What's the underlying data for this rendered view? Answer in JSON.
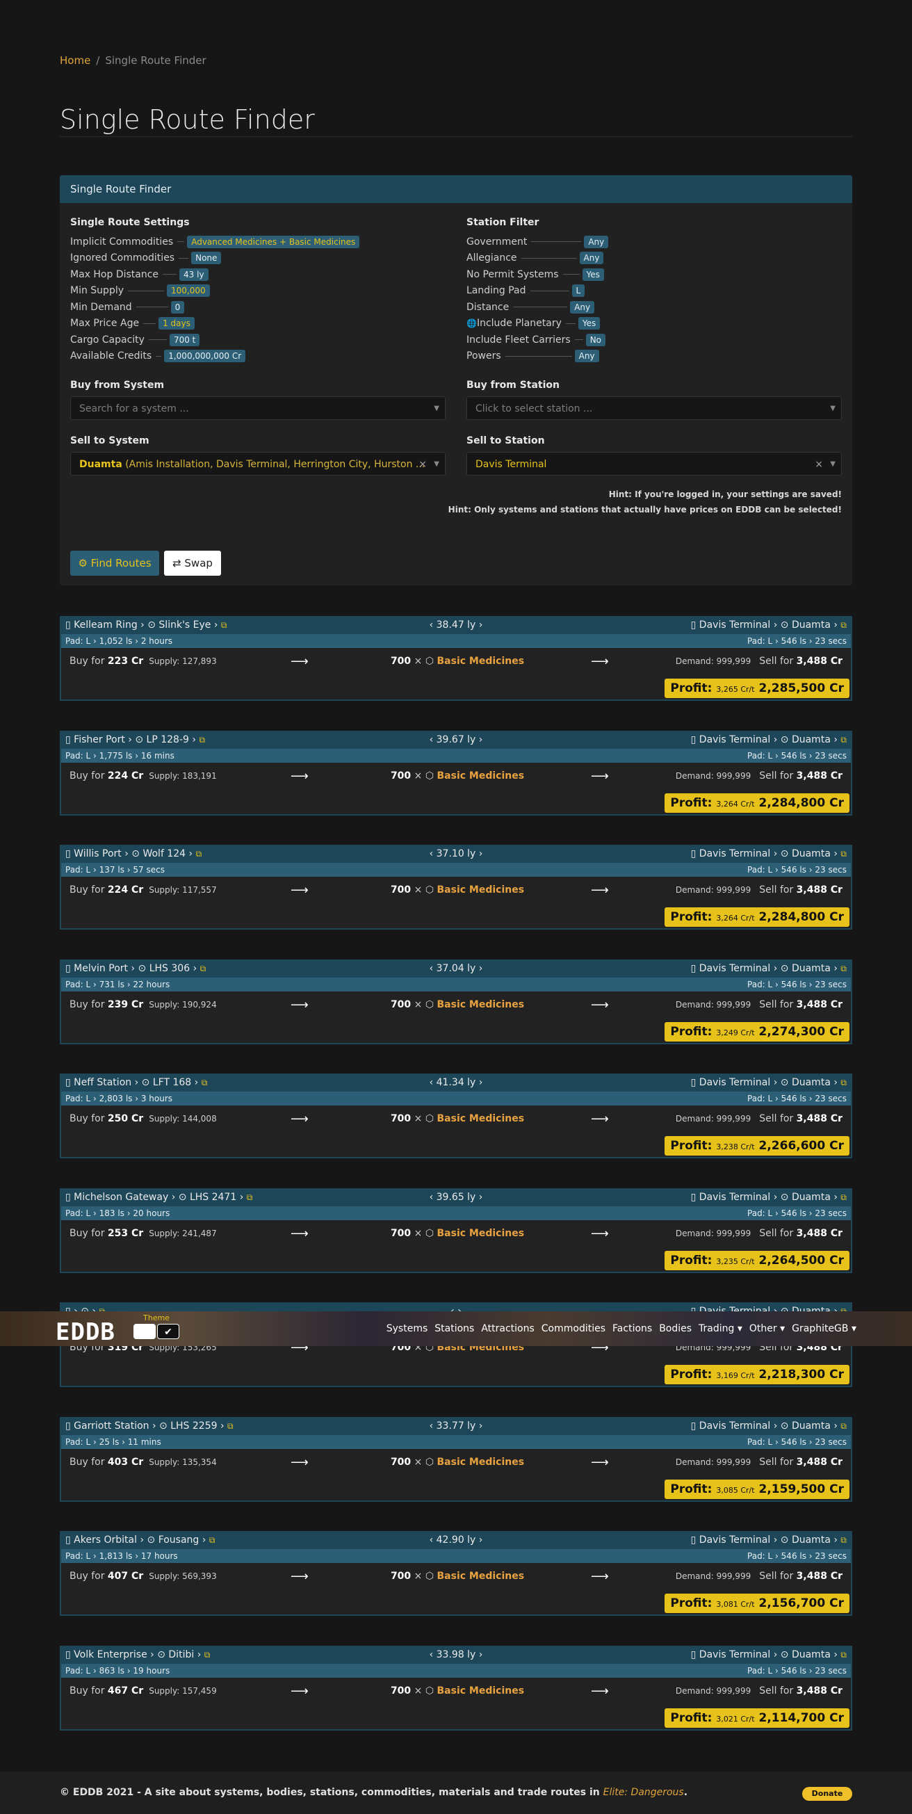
{
  "breadcrumb": {
    "home": "Home",
    "sep": "/",
    "current": "Single Route Finder"
  },
  "title": "Single Route Finder",
  "panel": {
    "header": "Single Route Finder",
    "settings": {
      "title": "Single Route Settings",
      "rows": [
        {
          "label": "Implicit Commodities",
          "value": "Advanced Medicines + Basic Medicines",
          "yellow": true
        },
        {
          "label": "Ignored Commodities",
          "value": "None",
          "yellow": false
        },
        {
          "label": "Max Hop Distance",
          "value": "43 ly",
          "yellow": false
        },
        {
          "label": "Min Supply",
          "value": "100,000",
          "yellow": true
        },
        {
          "label": "Min Demand",
          "value": "0",
          "yellow": false
        },
        {
          "label": "Max Price Age",
          "value": "1 days",
          "yellow": true
        },
        {
          "label": "Cargo Capacity",
          "value": "700 t",
          "yellow": false
        },
        {
          "label": "Available Credits",
          "value": "1,000,000,000 Cr",
          "yellow": false
        }
      ]
    },
    "filter": {
      "title": "Station Filter",
      "rows": [
        {
          "label": "Government",
          "value": "Any",
          "icon": ""
        },
        {
          "label": "Allegiance",
          "value": "Any",
          "icon": ""
        },
        {
          "label": "No Permit Systems",
          "value": "Yes",
          "icon": ""
        },
        {
          "label": "Landing Pad",
          "value": "L",
          "icon": ""
        },
        {
          "label": "Distance",
          "value": "Any",
          "icon": ""
        },
        {
          "label": "Include Planetary",
          "value": "Yes",
          "icon": "globe-icon"
        },
        {
          "label": "Include Fleet Carriers",
          "value": "No",
          "icon": ""
        },
        {
          "label": "Powers",
          "value": "Any",
          "icon": ""
        }
      ]
    },
    "buy_system": {
      "label": "Buy from System",
      "placeholder": "Search for a system ..."
    },
    "buy_station": {
      "label": "Buy from Station",
      "placeholder": "Click to select station ..."
    },
    "sell_system": {
      "label": "Sell to System",
      "name": "Duamta",
      "detail": "(Amis Installation, Davis Terminal, Herrington City, Hurston ..."
    },
    "sell_station": {
      "label": "Sell to Station",
      "value": "Davis Terminal"
    },
    "hints": [
      "Hint: If you're logged in, your settings are saved!",
      "Hint: Only systems and stations that actually have prices on EDDB can be selected!"
    ],
    "find_button": "Find Routes",
    "swap_button": "Swap"
  },
  "routes": [
    {
      "station": "Kelleam Ring",
      "system": "Slink's Eye",
      "dist": "38.47 ly",
      "pad": "Pad: L",
      "ls": "1,052 ls",
      "age": "2 hours",
      "buy": "223 Cr",
      "supply": "Supply: 127,893",
      "qty": "700",
      "commodity": "Basic Medicines",
      "demand": "Demand: 999,999",
      "sell": "3,488 Cr",
      "crt": "3,265 Cr/t",
      "profit": "2,285,500 Cr"
    },
    {
      "station": "Fisher Port",
      "system": "LP 128-9",
      "dist": "39.67 ly",
      "pad": "Pad: L",
      "ls": "1,775 ls",
      "age": "16 mins",
      "buy": "224 Cr",
      "supply": "Supply: 183,191",
      "qty": "700",
      "commodity": "Basic Medicines",
      "demand": "Demand: 999,999",
      "sell": "3,488 Cr",
      "crt": "3,264 Cr/t",
      "profit": "2,284,800 Cr"
    },
    {
      "station": "Willis Port",
      "system": "Wolf 124",
      "dist": "37.10 ly",
      "pad": "Pad: L",
      "ls": "137 ls",
      "age": "57 secs",
      "buy": "224 Cr",
      "supply": "Supply: 117,557",
      "qty": "700",
      "commodity": "Basic Medicines",
      "demand": "Demand: 999,999",
      "sell": "3,488 Cr",
      "crt": "3,264 Cr/t",
      "profit": "2,284,800 Cr"
    },
    {
      "station": "Melvin Port",
      "system": "LHS 306",
      "dist": "37.04 ly",
      "pad": "Pad: L",
      "ls": "731 ls",
      "age": "22 hours",
      "buy": "239 Cr",
      "supply": "Supply: 190,924",
      "qty": "700",
      "commodity": "Basic Medicines",
      "demand": "Demand: 999,999",
      "sell": "3,488 Cr",
      "crt": "3,249 Cr/t",
      "profit": "2,274,300 Cr"
    },
    {
      "station": "Neff Station",
      "system": "LFT 168",
      "dist": "41.34 ly",
      "pad": "Pad: L",
      "ls": "2,803 ls",
      "age": "3 hours",
      "buy": "250 Cr",
      "supply": "Supply: 144,008",
      "qty": "700",
      "commodity": "Basic Medicines",
      "demand": "Demand: 999,999",
      "sell": "3,488 Cr",
      "crt": "3,238 Cr/t",
      "profit": "2,266,600 Cr"
    },
    {
      "station": "Michelson Gateway",
      "system": "LHS 2471",
      "dist": "39.65 ly",
      "pad": "Pad: L",
      "ls": "183 ls",
      "age": "20 hours",
      "buy": "253 Cr",
      "supply": "Supply: 241,487",
      "qty": "700",
      "commodity": "Basic Medicines",
      "demand": "Demand: 999,999",
      "sell": "3,488 Cr",
      "crt": "3,235 Cr/t",
      "profit": "2,264,500 Cr"
    },
    {
      "station": "",
      "system": "",
      "dist": "",
      "pad": "",
      "ls": "",
      "age": "",
      "buy": "319 Cr",
      "supply": "Supply: 153,265",
      "qty": "700",
      "commodity": "Basic Medicines",
      "demand": "Demand: 999,999",
      "sell": "3,488 Cr",
      "crt": "3,169 Cr/t",
      "profit": "2,218,300 Cr"
    },
    {
      "station": "Garriott Station",
      "system": "LHS 2259",
      "dist": "33.77 ly",
      "pad": "Pad: L",
      "ls": "25 ls",
      "age": "11 mins",
      "buy": "403 Cr",
      "supply": "Supply: 135,354",
      "qty": "700",
      "commodity": "Basic Medicines",
      "demand": "Demand: 999,999",
      "sell": "3,488 Cr",
      "crt": "3,085 Cr/t",
      "profit": "2,159,500 Cr"
    },
    {
      "station": "Akers Orbital",
      "system": "Fousang",
      "dist": "42.90 ly",
      "pad": "Pad: L",
      "ls": "1,813 ls",
      "age": "17 hours",
      "buy": "407 Cr",
      "supply": "Supply: 569,393",
      "qty": "700",
      "commodity": "Basic Medicines",
      "demand": "Demand: 999,999",
      "sell": "3,488 Cr",
      "crt": "3,081 Cr/t",
      "profit": "2,156,700 Cr"
    },
    {
      "station": "Volk Enterprise",
      "system": "Ditibi",
      "dist": "33.98 ly",
      "pad": "Pad: L",
      "ls": "863 ls",
      "age": "19 hours",
      "buy": "467 Cr",
      "supply": "Supply: 157,459",
      "qty": "700",
      "commodity": "Basic Medicines",
      "demand": "Demand: 999,999",
      "sell": "3,488 Cr",
      "crt": "3,021 Cr/t",
      "profit": "2,114,700 Cr"
    }
  ],
  "dest": {
    "station": "Davis Terminal",
    "system": "Duamta",
    "pad": "Pad: L",
    "ls": "546 ls",
    "age": "23 secs"
  },
  "profit_label": "Profit:",
  "buy_for": "Buy for",
  "sell_for": "Sell for",
  "navbar": {
    "logo": "EDDB",
    "theme_label": "Theme",
    "items": [
      "Systems",
      "Stations",
      "Attractions",
      "Commodities",
      "Factions",
      "Bodies",
      "Trading ▾",
      "Other ▾",
      "GraphiteGB ▾"
    ]
  },
  "footer": {
    "text": "© EDDB 2021 - A site about systems, bodies, stations, commodities, materials and trade routes in ",
    "game": "Elite: Dangerous",
    "end": ".",
    "donate": "Donate"
  },
  "colors": {
    "accent": "#e6c21a",
    "header": "#1d4659",
    "sub": "#2c5f76",
    "link": "#e0a43a"
  }
}
